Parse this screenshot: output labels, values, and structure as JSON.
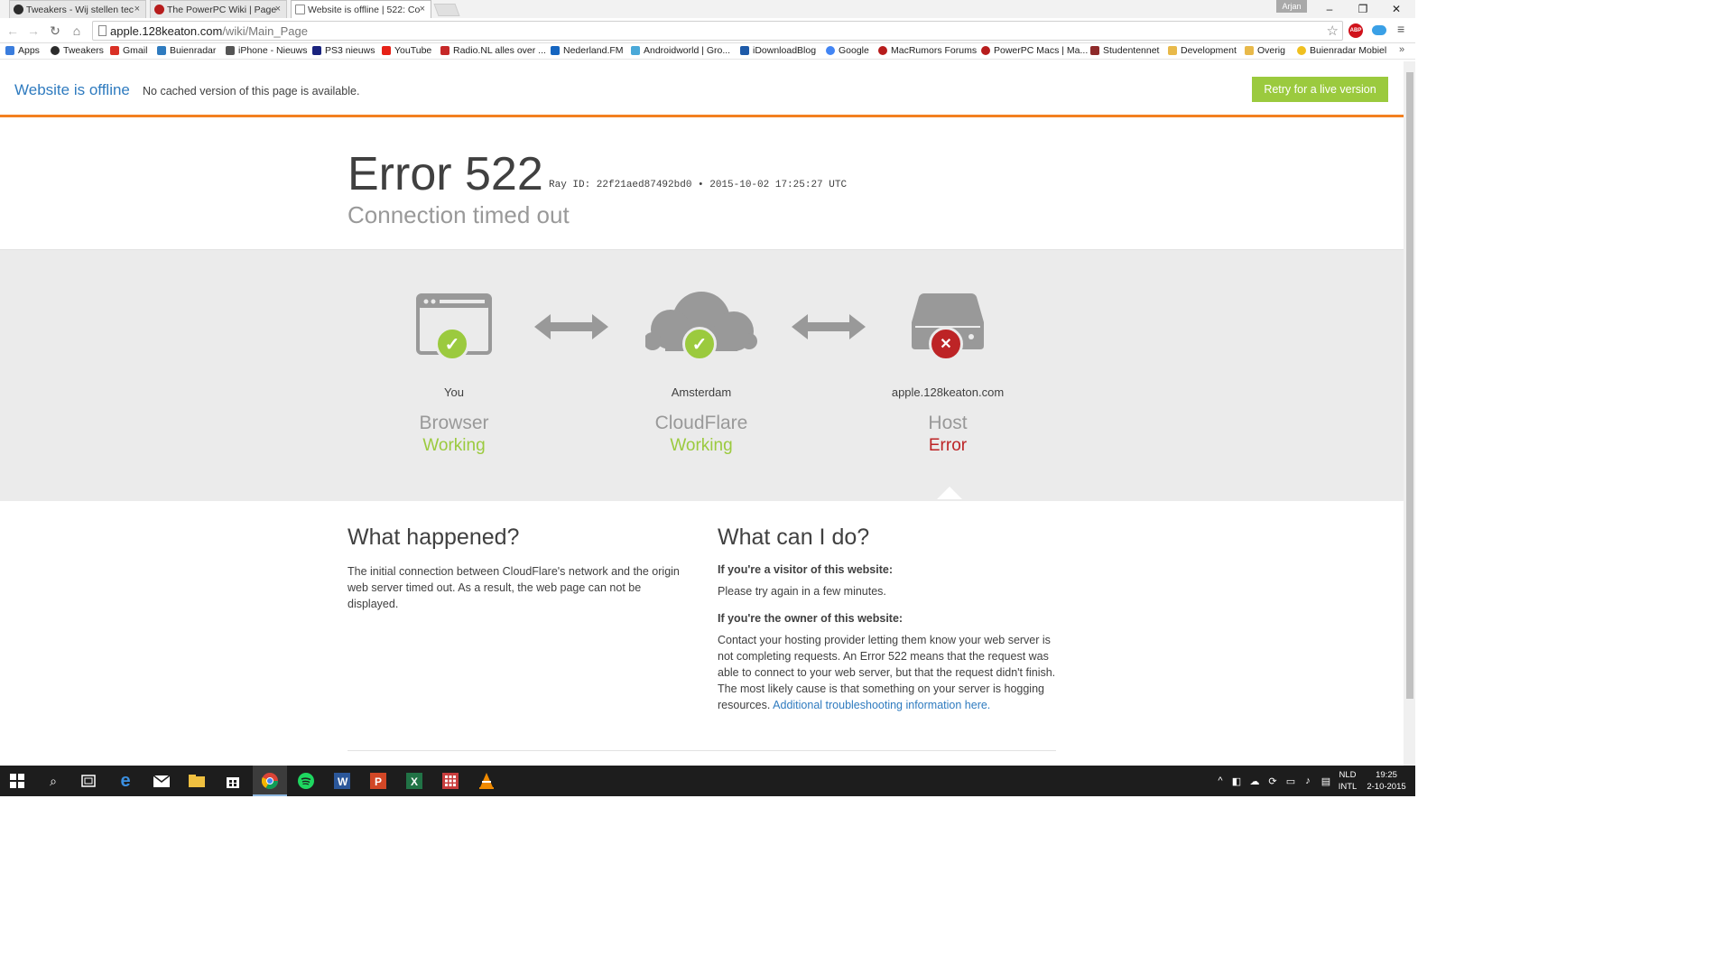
{
  "tabs": [
    {
      "title": "Tweakers - Wij stellen tec",
      "active": false
    },
    {
      "title": "The PowerPC Wiki | Page",
      "active": false
    },
    {
      "title": "Website is offline | 522: Co",
      "active": true
    }
  ],
  "window": {
    "user": "Arjan"
  },
  "address_bar": {
    "host": "apple.128keaton.com",
    "path": "/wiki/Main_Page"
  },
  "bookmarks": [
    {
      "label": "Apps",
      "icon": "apps-grid-icon",
      "color": "#3b7ddd"
    },
    {
      "label": "Tweakers",
      "icon": "tweakers-icon",
      "color": "#2b2b2b"
    },
    {
      "label": "Gmail",
      "icon": "gmail-icon",
      "color": "#d93025"
    },
    {
      "label": "Buienradar",
      "icon": "buienradar-icon",
      "color": "#2f7bbf"
    },
    {
      "label": "iPhone - Nieuws",
      "icon": "iphone-news-icon",
      "color": "#555555"
    },
    {
      "label": "PS3 nieuws",
      "icon": "psx-icon",
      "color": "#1a237e"
    },
    {
      "label": "YouTube",
      "icon": "youtube-icon",
      "color": "#e62117"
    },
    {
      "label": "Radio.NL alles over ...",
      "icon": "radio-nl-icon",
      "color": "#c62828"
    },
    {
      "label": "Nederland.FM",
      "icon": "nederland-fm-icon",
      "color": "#1565c0"
    },
    {
      "label": "Androidworld | Gro...",
      "icon": "android-icon",
      "color": "#4aa8d8"
    },
    {
      "label": "iDownloadBlog",
      "icon": "idb-icon",
      "color": "#1e5aa8"
    },
    {
      "label": "Google",
      "icon": "google-icon",
      "color": "#4285f4"
    },
    {
      "label": "MacRumors Forums",
      "icon": "macrumors-icon",
      "color": "#b71c1c"
    },
    {
      "label": "PowerPC Macs | Ma...",
      "icon": "powerpc-icon",
      "color": "#b71c1c"
    },
    {
      "label": "Studentennet",
      "icon": "studentennet-icon",
      "color": "#8e2a2a"
    },
    {
      "label": "Development",
      "icon": "folder-icon",
      "color": "#e8b94a"
    },
    {
      "label": "Overig",
      "icon": "folder-icon",
      "color": "#e8b94a"
    },
    {
      "label": "Buienradar Mobiel",
      "icon": "buienradar-mobile-icon",
      "color": "#f0c020"
    }
  ],
  "offline_banner": {
    "title": "Website is offline",
    "subtitle": "No cached version of this page is available.",
    "retry_label": "Retry for a live version"
  },
  "error": {
    "code": "Error 522",
    "ray": "Ray ID: 22f21aed87492bd0 • 2015-10-02 17:25:27 UTC",
    "description": "Connection timed out"
  },
  "nodes": [
    {
      "location": "You",
      "type": "Browser",
      "status": "Working",
      "ok": true,
      "icon": "browser-icon"
    },
    {
      "location": "Amsterdam",
      "type": "CloudFlare",
      "status": "Working",
      "ok": true,
      "icon": "cloud-icon"
    },
    {
      "location": "apple.128keaton.com",
      "type": "Host",
      "status": "Error",
      "ok": false,
      "icon": "server-icon"
    }
  ],
  "what_happened": {
    "heading": "What happened?",
    "text": "The initial connection between CloudFlare's network and the origin web server timed out. As a result, the web page can not be displayed."
  },
  "what_can_i_do": {
    "heading": "What can I do?",
    "visitor_heading": "If you're a visitor of this website:",
    "visitor_text": "Please try again in a few minutes.",
    "owner_heading": "If you're the owner of this website:",
    "owner_text": "Contact your hosting provider letting them know your web server is not completing requests. An Error 522 means that the request was able to connect to your web server, but that the request didn't finish. The most likely cause is that something on your server is hogging resources.",
    "owner_link": "Additional troubleshooting information here."
  },
  "taskbar": {
    "language": "NLD",
    "layout": "INTL",
    "time": "19:25",
    "date": "2-10-2015"
  },
  "colors": {
    "accent_orange": "#f38020",
    "ok_green": "#9bca3e",
    "error_red": "#bd2426",
    "link_blue": "#2f7bbf"
  }
}
